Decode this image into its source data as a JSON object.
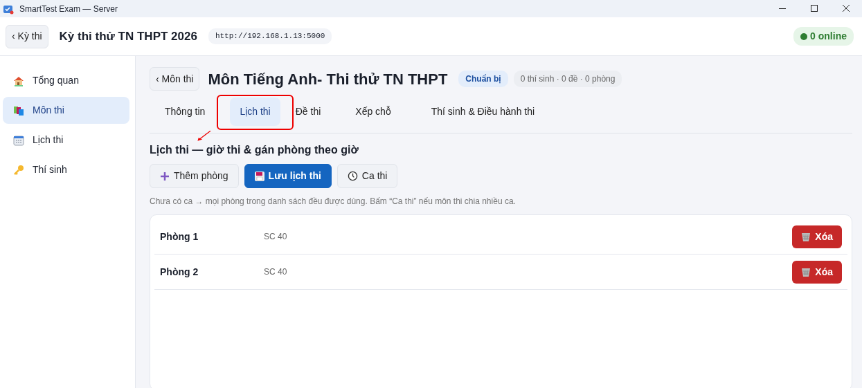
{
  "window": {
    "title": "SmartTest Exam — Server"
  },
  "header": {
    "back": "‹ Kỳ thi",
    "title": "Kỳ thi thử TN THPT 2026",
    "url": "http://192.168.1.13:5000",
    "online": "0 online"
  },
  "sidebar": {
    "items": [
      {
        "label": "Tổng quan",
        "selected": false
      },
      {
        "label": "Môn thi",
        "selected": true
      },
      {
        "label": "Lịch thi",
        "selected": false
      },
      {
        "label": "Thí sinh",
        "selected": false
      }
    ]
  },
  "subject": {
    "back": "‹ Môn thi",
    "title": "Môn Tiếng Anh- Thi thử TN THPT",
    "status": "Chuẩn bị",
    "stats": "0 thí sinh · 0 đề · 0 phòng"
  },
  "tabs": [
    {
      "label": "Thông tin",
      "selected": false
    },
    {
      "label": "Lịch thi",
      "selected": true
    },
    {
      "label": "Đề thi",
      "selected": false
    },
    {
      "label": "Xếp chỗ",
      "selected": false
    },
    {
      "label": "Thí sinh & Điều hành thi",
      "selected": false
    }
  ],
  "section": {
    "title": "Lịch thi — giờ thi & gán phòng theo giờ",
    "buttons": [
      {
        "label": "Thêm phòng",
        "primary": false
      },
      {
        "label": "Lưu lịch thi",
        "primary": true
      },
      {
        "label": "Ca thi",
        "primary": false
      }
    ],
    "hint": "Chưa có ca → mọi phòng trong danh sách đều được dùng. Bấm “Ca thi” nếu môn thi chia nhiều ca."
  },
  "rooms": [
    {
      "name": "Phòng 1",
      "code": "SC 40",
      "action": "Xóa"
    },
    {
      "name": "Phòng 2",
      "code": "SC 40",
      "action": "Xóa"
    }
  ],
  "annotations": [
    {
      "kind": "box"
    },
    {
      "kind": "arrow"
    }
  ]
}
